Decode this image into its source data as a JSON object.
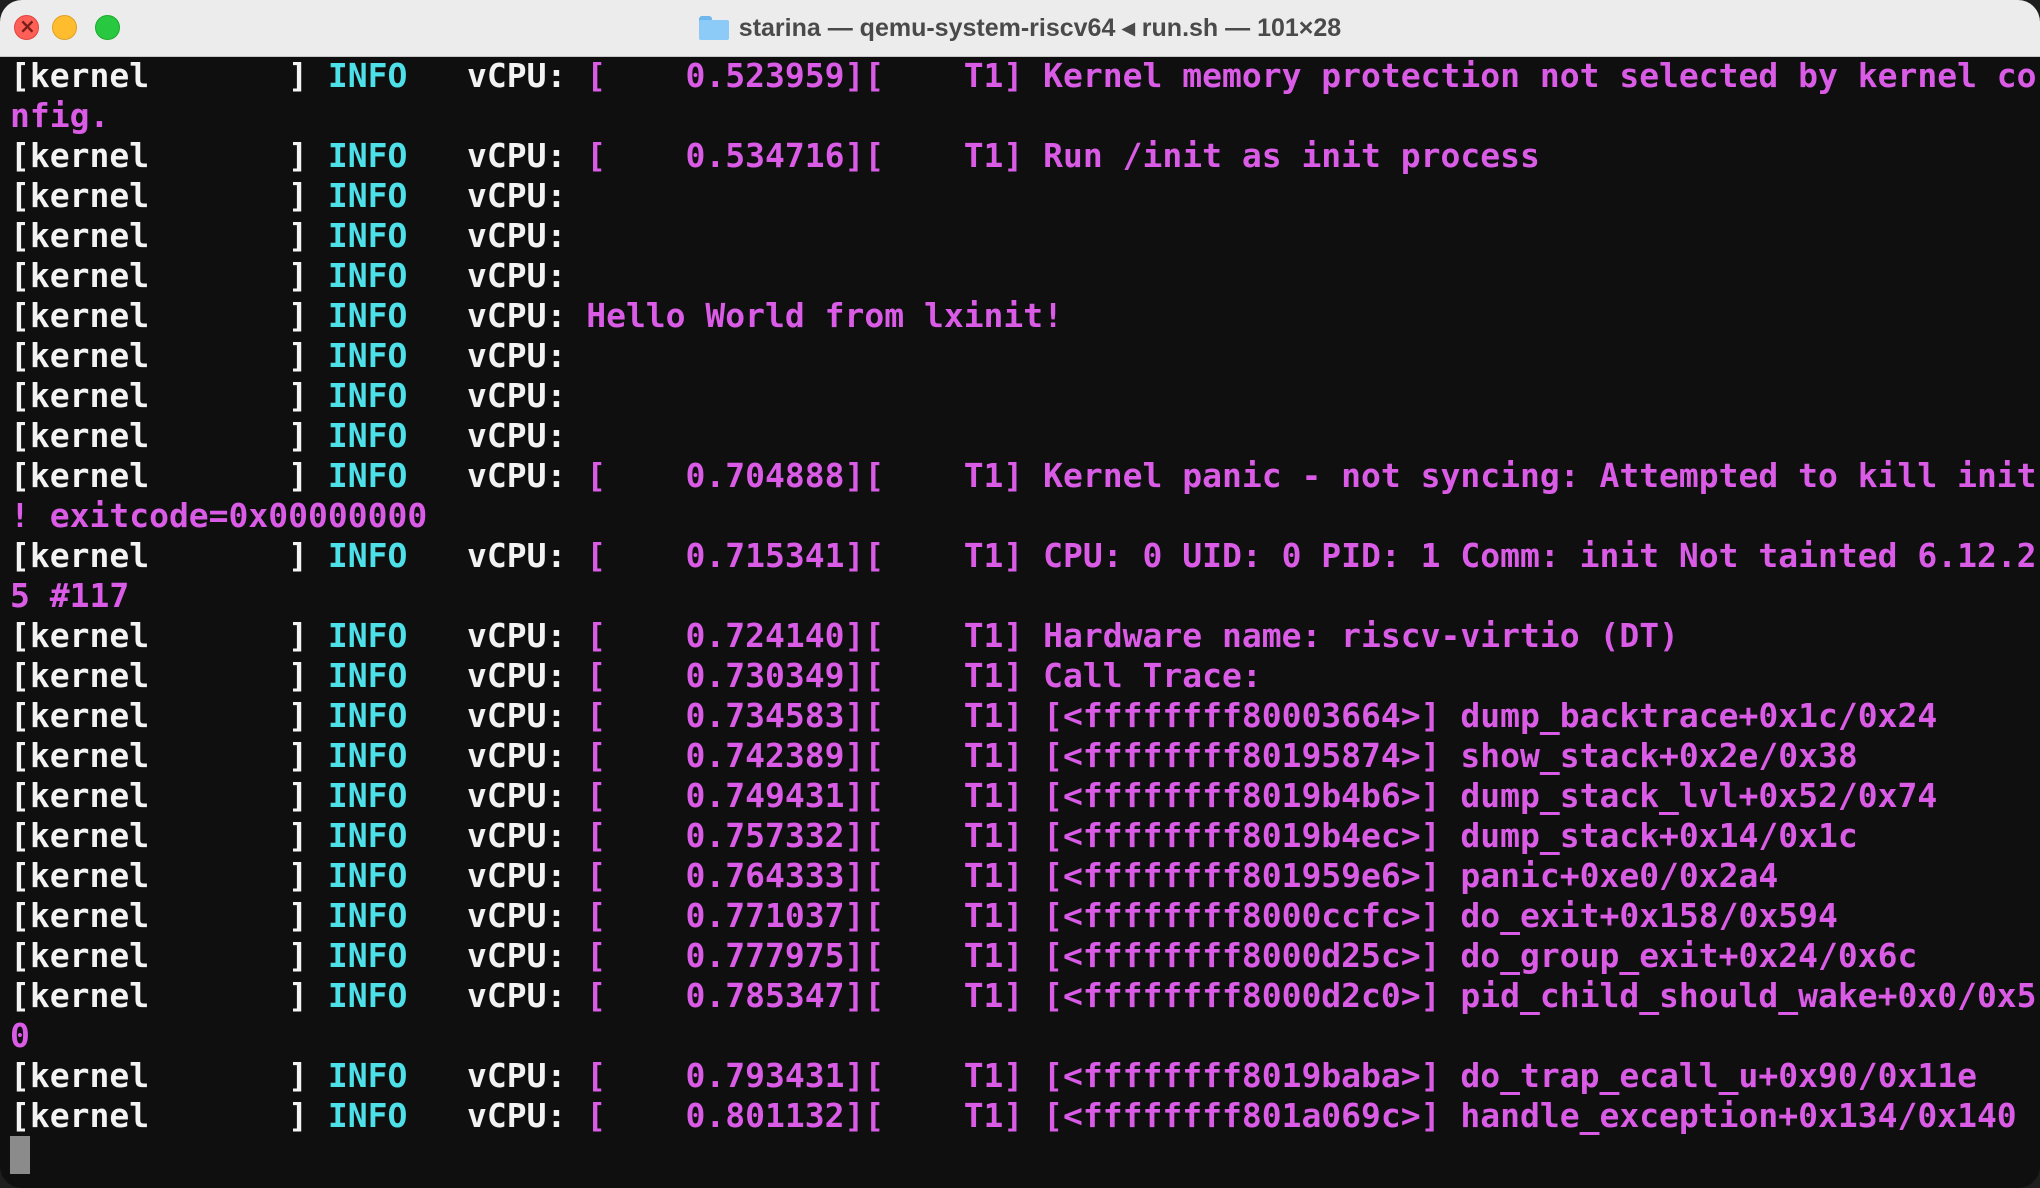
{
  "window": {
    "title": "starina — qemu-system-riscv64 ◂ run.sh — 101×28"
  },
  "terminal": {
    "lines": [
      {
        "prefix": "[kernel       ]",
        "level": "INFO",
        "vcpu": "vCPU:",
        "text": "[    0.523959][    T1] Kernel memory protection not selected by kernel co"
      },
      {
        "prefix": "",
        "level": "",
        "vcpu": "",
        "text": "nfig."
      },
      {
        "prefix": "[kernel       ]",
        "level": "INFO",
        "vcpu": "vCPU:",
        "text": "[    0.534716][    T1] Run /init as init process"
      },
      {
        "prefix": "[kernel       ]",
        "level": "INFO",
        "vcpu": "vCPU:",
        "text": ""
      },
      {
        "prefix": "[kernel       ]",
        "level": "INFO",
        "vcpu": "vCPU:",
        "text": ""
      },
      {
        "prefix": "[kernel       ]",
        "level": "INFO",
        "vcpu": "vCPU:",
        "text": ""
      },
      {
        "prefix": "[kernel       ]",
        "level": "INFO",
        "vcpu": "vCPU:",
        "text": "Hello World from lxinit!"
      },
      {
        "prefix": "[kernel       ]",
        "level": "INFO",
        "vcpu": "vCPU:",
        "text": ""
      },
      {
        "prefix": "[kernel       ]",
        "level": "INFO",
        "vcpu": "vCPU:",
        "text": ""
      },
      {
        "prefix": "[kernel       ]",
        "level": "INFO",
        "vcpu": "vCPU:",
        "text": ""
      },
      {
        "prefix": "[kernel       ]",
        "level": "INFO",
        "vcpu": "vCPU:",
        "text": "[    0.704888][    T1] Kernel panic - not syncing: Attempted to kill init"
      },
      {
        "prefix": "",
        "level": "",
        "vcpu": "",
        "text": "! exitcode=0x00000000"
      },
      {
        "prefix": "[kernel       ]",
        "level": "INFO",
        "vcpu": "vCPU:",
        "text": "[    0.715341][    T1] CPU: 0 UID: 0 PID: 1 Comm: init Not tainted 6.12.2"
      },
      {
        "prefix": "",
        "level": "",
        "vcpu": "",
        "text": "5 #117"
      },
      {
        "prefix": "[kernel       ]",
        "level": "INFO",
        "vcpu": "vCPU:",
        "text": "[    0.724140][    T1] Hardware name: riscv-virtio (DT)"
      },
      {
        "prefix": "[kernel       ]",
        "level": "INFO",
        "vcpu": "vCPU:",
        "text": "[    0.730349][    T1] Call Trace:"
      },
      {
        "prefix": "[kernel       ]",
        "level": "INFO",
        "vcpu": "vCPU:",
        "text": "[    0.734583][    T1] [<ffffffff80003664>] dump_backtrace+0x1c/0x24"
      },
      {
        "prefix": "[kernel       ]",
        "level": "INFO",
        "vcpu": "vCPU:",
        "text": "[    0.742389][    T1] [<ffffffff80195874>] show_stack+0x2e/0x38"
      },
      {
        "prefix": "[kernel       ]",
        "level": "INFO",
        "vcpu": "vCPU:",
        "text": "[    0.749431][    T1] [<ffffffff8019b4b6>] dump_stack_lvl+0x52/0x74"
      },
      {
        "prefix": "[kernel       ]",
        "level": "INFO",
        "vcpu": "vCPU:",
        "text": "[    0.757332][    T1] [<ffffffff8019b4ec>] dump_stack+0x14/0x1c"
      },
      {
        "prefix": "[kernel       ]",
        "level": "INFO",
        "vcpu": "vCPU:",
        "text": "[    0.764333][    T1] [<ffffffff801959e6>] panic+0xe0/0x2a4"
      },
      {
        "prefix": "[kernel       ]",
        "level": "INFO",
        "vcpu": "vCPU:",
        "text": "[    0.771037][    T1] [<ffffffff8000ccfc>] do_exit+0x158/0x594"
      },
      {
        "prefix": "[kernel       ]",
        "level": "INFO",
        "vcpu": "vCPU:",
        "text": "[    0.777975][    T1] [<ffffffff8000d25c>] do_group_exit+0x24/0x6c"
      },
      {
        "prefix": "[kernel       ]",
        "level": "INFO",
        "vcpu": "vCPU:",
        "text": "[    0.785347][    T1] [<ffffffff8000d2c0>] pid_child_should_wake+0x0/0x5"
      },
      {
        "prefix": "",
        "level": "",
        "vcpu": "",
        "text": "0"
      },
      {
        "prefix": "[kernel       ]",
        "level": "INFO",
        "vcpu": "vCPU:",
        "text": "[    0.793431][    T1] [<ffffffff8019baba>] do_trap_ecall_u+0x90/0x11e"
      },
      {
        "prefix": "[kernel       ]",
        "level": "INFO",
        "vcpu": "vCPU:",
        "text": "[    0.801132][    T1] [<ffffffff801a069c>] handle_exception+0x134/0x140"
      }
    ]
  },
  "colors": {
    "background": "#0f0f10",
    "info": "#4de0e8",
    "message": "#da5ce6",
    "plain": "#f3f3f3"
  }
}
